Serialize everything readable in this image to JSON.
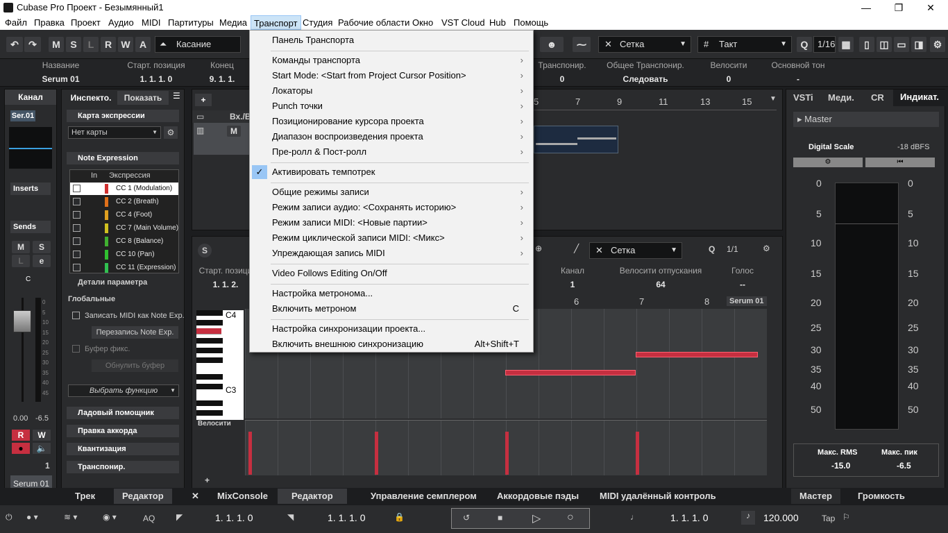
{
  "window": {
    "title": "Cubase Pro Проект - Безымянный1",
    "minimize": "—",
    "maximize": "❐",
    "close": "✕"
  },
  "menubar": [
    "Файл",
    "Правка",
    "Проект",
    "Аудио",
    "MIDI",
    "Партитуры",
    "Медиа",
    "Транспорт",
    "Студия",
    "Рабочие области",
    "Окно",
    "VST Cloud",
    "Hub",
    "Помощь"
  ],
  "toolbar": {
    "undo": "↶",
    "redo": "↷",
    "m": "M",
    "s": "S",
    "l": "L",
    "r": "R",
    "w": "W",
    "a": "A",
    "mode": "Касание",
    "snap_type": "Сетка",
    "grid": "Такт",
    "quantize": "1/16"
  },
  "infoline": [
    {
      "label": "Название",
      "value": "Serum 01"
    },
    {
      "label": "Старт. позиция",
      "value": "1. 1. 1.   0"
    },
    {
      "label": "Конец",
      "value": "9. 1. 1."
    },
    {
      "label": "Транспонир.",
      "value": "0"
    },
    {
      "label": "Общее Транспонир.",
      "value": "Следовать"
    },
    {
      "label": "Велосити",
      "value": "0"
    },
    {
      "label": "Основной тон",
      "value": "-"
    }
  ],
  "channel": {
    "title": "Канал",
    "name": "Ser.01",
    "inserts": "Inserts",
    "sends": "Sends",
    "m": "M",
    "s": "S",
    "l": "L",
    "e": "e",
    "c": "C",
    "vol": "0.00",
    "pan": "-6.5",
    "r": "R",
    "w": "W",
    "num": "1",
    "instrument": "Serum 01",
    "scale": [
      "0",
      "5",
      "10",
      "15",
      "20",
      "25",
      "30",
      "35",
      "40",
      "45",
      "50"
    ]
  },
  "inspector": {
    "tab1": "Инспекто.",
    "tab2": "Показать",
    "menu": "☰",
    "expr_map": "Карта экспрессии",
    "no_map": "Нет карты",
    "note_expr": "Note Expression",
    "col_in": "In",
    "col_expr": "Экспрессия",
    "cc": [
      {
        "label": "CC 1  (Modulation)",
        "color": "#d03030"
      },
      {
        "label": "CC 2  (Breath)",
        "color": "#e0701a"
      },
      {
        "label": "CC 4  (Foot)",
        "color": "#e0a020"
      },
      {
        "label": "CC 7  (Main Volume)",
        "color": "#d0c020"
      },
      {
        "label": "CC 8  (Balance)",
        "color": "#40b030"
      },
      {
        "label": "CC 10  (Pan)",
        "color": "#30c030"
      },
      {
        "label": "CC 11  (Expression)",
        "color": "#30c050"
      }
    ],
    "details": "Детали параметра",
    "global": "Глобальные",
    "record_midi": "Записать MIDI как Note Exp.",
    "rerecord": "Перезапись Note Exp.",
    "buffer": "Буфер фикс.",
    "reset_buffer": "Обнулить буфер",
    "select_fn": "Выбрать функцию",
    "sections": [
      "Ладовый помощник",
      "Правка аккорда",
      "Квантизация",
      "Транспонир."
    ]
  },
  "tracks": {
    "header": "Вх./В",
    "ruler": [
      "5",
      "7",
      "9",
      "11",
      "13",
      "15"
    ]
  },
  "editor": {
    "snap": "Сетка",
    "q": "1/1",
    "cols": [
      {
        "label": "Старт. позици",
        "value": "1. 1. 2."
      },
      {
        "label": "Канал",
        "value": "1"
      },
      {
        "label": "Велосити отпускания",
        "value": "64"
      },
      {
        "label": "Голос",
        "value": "--"
      }
    ],
    "ruler": [
      "6",
      "7",
      "8"
    ],
    "instr": "Serum 01",
    "c4": "C4",
    "c3": "C3",
    "velocity": "Велосити"
  },
  "menu": {
    "items": [
      {
        "label": "Панель Транспорта",
        "sub": false
      },
      {
        "label": "Команды транспорта",
        "sub": true
      },
      {
        "label": "Start Mode: <Start from Project Cursor Position>",
        "sub": true
      },
      {
        "label": "Локаторы",
        "sub": true
      },
      {
        "label": "Punch точки",
        "sub": true
      },
      {
        "label": "Позиционирование курсора проекта",
        "sub": true
      },
      {
        "label": "Диапазон воспроизведения проекта",
        "sub": true
      },
      {
        "label": "Пре-ролл & Пост-ролл",
        "sub": true
      },
      {
        "label": "Активировать темпотрек",
        "sub": false,
        "checked": true
      },
      {
        "label": "Общие режимы записи",
        "sub": true
      },
      {
        "label": "Режим записи аудио: <Сохранять историю>",
        "sub": true
      },
      {
        "label": "Режим записи MIDI: <Новые партии>",
        "sub": true
      },
      {
        "label": "Режим циклической записи MIDI: <Микс>",
        "sub": true
      },
      {
        "label": "Упреждающая запись MIDI",
        "sub": true
      },
      {
        "label": "Video Follows Editing On/Off",
        "sub": false
      },
      {
        "label": "Настройка метронома...",
        "sub": false
      },
      {
        "label": "Включить метроном",
        "sub": false,
        "shortcut": "C"
      },
      {
        "label": "Настройка синхронизации проекта...",
        "sub": false
      },
      {
        "label": "Включить внешнюю синхронизацию",
        "sub": false,
        "shortcut": "Alt+Shift+T"
      }
    ],
    "submark": "›",
    "checkmark": "✓"
  },
  "right": {
    "tabs": [
      "VSTi",
      "Меди.",
      "CR",
      "Индикат."
    ],
    "master": "Master",
    "digital_scale": "Digital Scale",
    "dbfs": "-18 dBFS",
    "scale": [
      "0",
      "5",
      "10",
      "15",
      "20",
      "25",
      "30",
      "35",
      "40",
      "50"
    ],
    "rms_label": "Макс. RMS",
    "peak_label": "Макс. пик",
    "rms": "-15.0",
    "peak": "-6.5",
    "bottom_tabs": [
      "Мастер",
      "Громкость"
    ]
  },
  "bottom_tabs": [
    "Трек",
    "Редактор",
    "MixConsole",
    "Редактор",
    "Управление семплером",
    "Аккордовые пэды",
    "MIDI удалённый контроль"
  ],
  "transport": {
    "aq": "AQ",
    "left_loc": "1. 1. 1.   0",
    "right_loc": "1. 1. 1.   0",
    "pos": "1. 1. 1.   0",
    "tempo": "120.000",
    "tap": "Tap"
  },
  "colors": {
    "accent": "#c62f40",
    "menu_highlight": "#99c6f5",
    "panel": "#2a2b2d"
  }
}
